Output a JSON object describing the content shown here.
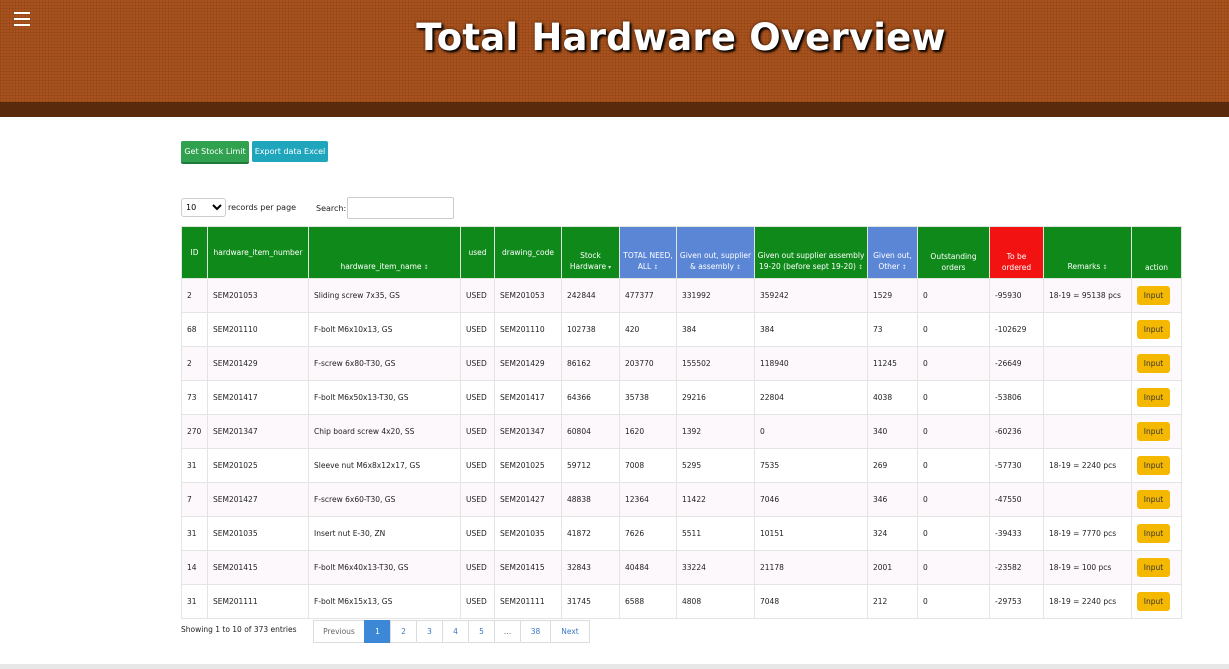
{
  "header": {
    "title": "Total Hardware Overview",
    "menu_icon": "hamburger-menu-icon"
  },
  "toolbar": {
    "stock_limit_label": "Get Stock Limit",
    "export_label": "Export data Excel"
  },
  "controls": {
    "page_size": "10",
    "records_label": "records per page",
    "search_label": "Search:",
    "search_value": ""
  },
  "table": {
    "columns": [
      "ID",
      "hardware_item_number",
      "hardware_item_name",
      "used",
      "drawing_code",
      "Stock Hardware",
      "TOTAL NEED, ALL",
      "Given out, supplier & assembly",
      "Given out supplier assembly 19-20 (before sept 19-20)",
      "Given out, Other",
      "Outstanding orders",
      "To be ordered",
      "Remarks",
      "action"
    ],
    "rows": [
      [
        "2",
        "SEM201053",
        "Sliding screw 7x35, GS",
        "USED",
        "SEM201053",
        "242844",
        "477377",
        "331992",
        "359242",
        "1529",
        "0",
        "-95930",
        "18-19 = 95138 pcs",
        "Input"
      ],
      [
        "68",
        "SEM201110",
        "F-bolt M6x10x13, GS",
        "USED",
        "SEM201110",
        "102738",
        "420",
        "384",
        "384",
        "73",
        "0",
        "-102629",
        "",
        "Input"
      ],
      [
        "2",
        "SEM201429",
        "F-screw 6x80-T30, GS",
        "USED",
        "SEM201429",
        "86162",
        "203770",
        "155502",
        "118940",
        "11245",
        "0",
        "-26649",
        "",
        "Input"
      ],
      [
        "73",
        "SEM201417",
        "F-bolt M6x50x13-T30, GS",
        "USED",
        "SEM201417",
        "64366",
        "35738",
        "29216",
        "22804",
        "4038",
        "0",
        "-53806",
        "",
        "Input"
      ],
      [
        "270",
        "SEM201347",
        "Chip board screw 4x20, SS",
        "USED",
        "SEM201347",
        "60804",
        "1620",
        "1392",
        "0",
        "340",
        "0",
        "-60236",
        "",
        "Input"
      ],
      [
        "31",
        "SEM201025",
        "Sleeve nut M6x8x12x17, GS",
        "USED",
        "SEM201025",
        "59712",
        "7008",
        "5295",
        "7535",
        "269",
        "0",
        "-57730",
        "18-19 = 2240 pcs",
        "Input"
      ],
      [
        "7",
        "SEM201427",
        "F-screw 6x60-T30, GS",
        "USED",
        "SEM201427",
        "48838",
        "12364",
        "11422",
        "7046",
        "346",
        "0",
        "-47550",
        "",
        "Input"
      ],
      [
        "31",
        "SEM201035",
        "Insert nut E-30, ZN",
        "USED",
        "SEM201035",
        "41872",
        "7626",
        "5511",
        "10151",
        "324",
        "0",
        "-39433",
        "18-19 = 7770 pcs",
        "Input"
      ],
      [
        "14",
        "SEM201415",
        "F-bolt M6x40x13-T30, GS",
        "USED",
        "SEM201415",
        "32843",
        "40484",
        "33224",
        "21178",
        "2001",
        "0",
        "-23582",
        "18-19 = 100 pcs",
        "Input"
      ],
      [
        "31",
        "SEM201111",
        "F-bolt M6x15x13, GS",
        "USED",
        "SEM201111",
        "31745",
        "6588",
        "4808",
        "7048",
        "212",
        "0",
        "-29753",
        "18-19 = 2240 pcs",
        "Input"
      ]
    ]
  },
  "footer": {
    "info": "Showing 1 to 10 of 373 entries",
    "pagination": [
      "Previous",
      "1",
      "2",
      "3",
      "4",
      "5",
      "…",
      "38",
      "Next"
    ],
    "active_page": "1"
  },
  "colors": {
    "header_brown": "#a9521d",
    "green": "#0f8a1a",
    "blue": "#5b86d6",
    "red": "#f21212",
    "input_yellow": "#f5b800"
  }
}
